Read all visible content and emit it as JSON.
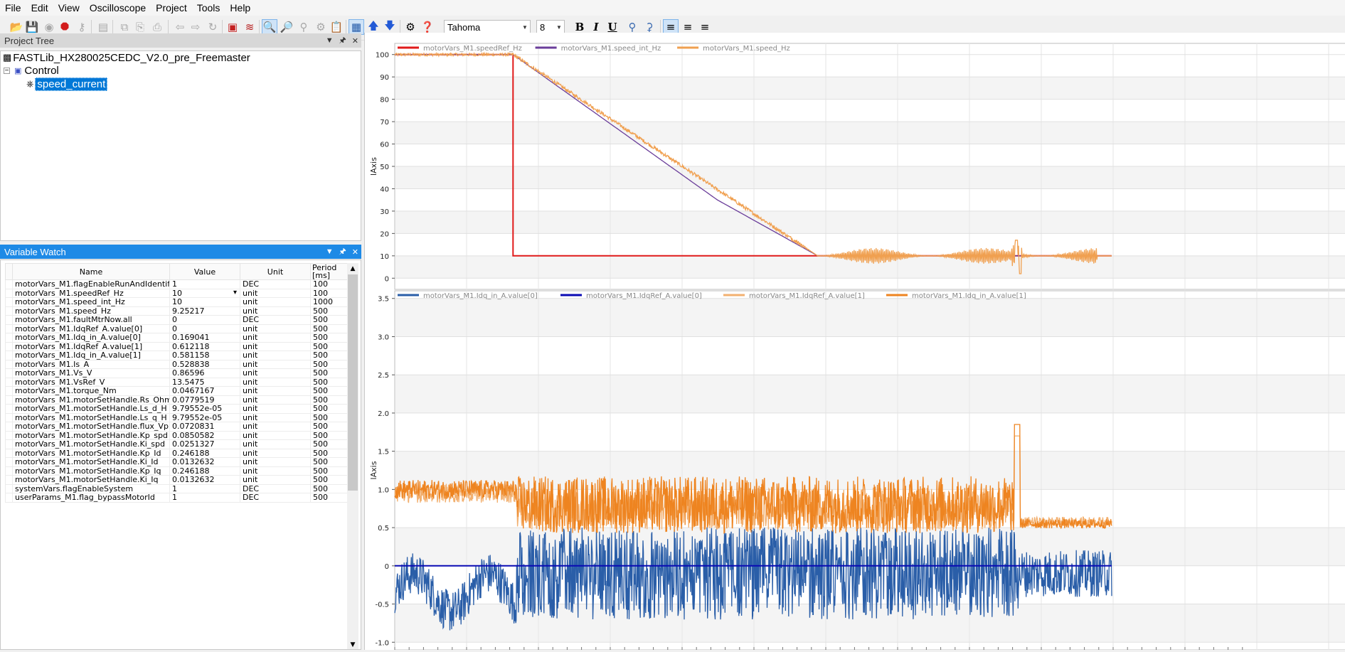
{
  "menu": [
    "File",
    "Edit",
    "View",
    "Oscilloscope",
    "Project",
    "Tools",
    "Help"
  ],
  "toolbar": {
    "font_name": "Tahoma",
    "font_size": "8"
  },
  "tree": {
    "title": "Project Tree",
    "root": "FASTLib_HX280025CEDC_V2.0_pre_Freemaster",
    "group": "Control",
    "item": "speed_current"
  },
  "watch": {
    "title": "Variable Watch",
    "columns": [
      "Name",
      "Value",
      "Unit",
      "Period [ms]"
    ],
    "rows": [
      {
        "name": "motorVars_M1.flagEnableRunAndIdentify",
        "value": "1",
        "unit": "DEC",
        "period": "100"
      },
      {
        "name": "motorVars_M1.speedRef_Hz",
        "value": "10",
        "unit": "unit",
        "period": "100"
      },
      {
        "name": "motorVars_M1.speed_int_Hz",
        "value": "10",
        "unit": "unit",
        "period": "1000"
      },
      {
        "name": "motorVars_M1.speed_Hz",
        "value": "9.25217",
        "unit": "unit",
        "period": "500"
      },
      {
        "name": "motorVars_M1.faultMtrNow.all",
        "value": "0",
        "unit": "DEC",
        "period": "500"
      },
      {
        "name": "motorVars_M1.IdqRef_A.value[0]",
        "value": "0",
        "unit": "unit",
        "period": "500"
      },
      {
        "name": "motorVars_M1.Idq_in_A.value[0]",
        "value": "0.169041",
        "unit": "unit",
        "period": "500"
      },
      {
        "name": "motorVars_M1.IdqRef_A.value[1]",
        "value": "0.612118",
        "unit": "unit",
        "period": "500"
      },
      {
        "name": "motorVars_M1.Idq_in_A.value[1]",
        "value": "0.581158",
        "unit": "unit",
        "period": "500"
      },
      {
        "name": "motorVars_M1.Is_A",
        "value": "0.528838",
        "unit": "unit",
        "period": "500"
      },
      {
        "name": "motorVars_M1.Vs_V",
        "value": "0.86596",
        "unit": "unit",
        "period": "500"
      },
      {
        "name": "motorVars_M1.VsRef_V",
        "value": "13.5475",
        "unit": "unit",
        "period": "500"
      },
      {
        "name": "motorVars_M1.torque_Nm",
        "value": "0.0467167",
        "unit": "unit",
        "period": "500"
      },
      {
        "name": "motorVars_M1.motorSetHandle.Rs_Ohm",
        "value": "0.0779519",
        "unit": "unit",
        "period": "500"
      },
      {
        "name": "motorVars_M1.motorSetHandle.Ls_d_H",
        "value": "9.79552e-05",
        "unit": "unit",
        "period": "500"
      },
      {
        "name": "motorVars_M1.motorSetHandle.Ls_q_H",
        "value": "9.79552e-05",
        "unit": "unit",
        "period": "500"
      },
      {
        "name": "motorVars_M1.motorSetHandle.flux_VpHz",
        "value": "0.0720831",
        "unit": "unit",
        "period": "500"
      },
      {
        "name": "motorVars_M1.motorSetHandle.Kp_spd",
        "value": "0.0850582",
        "unit": "unit",
        "period": "500"
      },
      {
        "name": "motorVars_M1.motorSetHandle.Ki_spd",
        "value": "0.0251327",
        "unit": "unit",
        "period": "500"
      },
      {
        "name": "motorVars_M1.motorSetHandle.Kp_Id",
        "value": "0.246188",
        "unit": "unit",
        "period": "500"
      },
      {
        "name": "motorVars_M1.motorSetHandle.Ki_Id",
        "value": "0.0132632",
        "unit": "unit",
        "period": "500"
      },
      {
        "name": "motorVars_M1.motorSetHandle.Kp_Iq",
        "value": "0.246188",
        "unit": "unit",
        "period": "500"
      },
      {
        "name": "motorVars_M1.motorSetHandle.Ki_Iq",
        "value": "0.0132632",
        "unit": "unit",
        "period": "500"
      },
      {
        "name": "systemVars.flagEnableSystem",
        "value": "1",
        "unit": "DEC",
        "period": "500"
      },
      {
        "name": "userParams_M1.flag_bypassMotorId",
        "value": "1",
        "unit": "DEC",
        "period": "500"
      }
    ]
  },
  "chart_data": [
    {
      "type": "line",
      "ylabel": "lAxis",
      "ylim": [
        -5,
        105
      ],
      "yticks": [
        0,
        10,
        20,
        30,
        40,
        50,
        60,
        70,
        80,
        90,
        100
      ],
      "legend_position": "top-left",
      "series": [
        {
          "name": "motorVars_M1.speedRef_Hz",
          "color": "#e01a1a",
          "x": [
            0,
            0.165,
            0.165,
            1
          ],
          "values": [
            100,
            100,
            10,
            10
          ]
        },
        {
          "name": "motorVars_M1.speed_int_Hz",
          "color": "#6a3d9a",
          "x": [
            0,
            0.165,
            0.45,
            0.59,
            1
          ],
          "values": [
            100,
            100,
            35,
            10,
            10
          ]
        },
        {
          "name": "motorVars_M1.speed_Hz",
          "color": "#f0a050",
          "x": [
            0,
            0.165,
            0.45,
            0.55,
            0.59,
            0.63,
            0.7,
            0.8,
            0.865,
            0.87,
            0.875,
            0.88,
            0.9,
            1
          ],
          "values": [
            100,
            101,
            35,
            18,
            11,
            7,
            13,
            8,
            17,
            3,
            14,
            9,
            11,
            10
          ]
        }
      ]
    },
    {
      "type": "line",
      "ylabel": "lAxis",
      "ylim": [
        -1.1,
        3.6
      ],
      "yticks": [
        -1.0,
        -0.5,
        0,
        0.5,
        1.0,
        1.5,
        2.0,
        2.5,
        3.0,
        3.5
      ],
      "legend_position": "top-left",
      "series": [
        {
          "name": "motorVars_M1.Idq_in_A.value[0]",
          "color": "#2a5ea8",
          "x": [
            0,
            0.1,
            0.17,
            0.9,
            0.97
          ],
          "values": [
            -0.6,
            -0.3,
            -1.0,
            0.4,
            0.1
          ]
        },
        {
          "name": "motorVars_M1.IdqRef_A.value[0]",
          "color": "#0a0ab4",
          "x": [
            0,
            0.97
          ],
          "values": [
            0,
            0
          ]
        },
        {
          "name": "motorVars_M1.IdqRef_A.value[1]",
          "color": "#f2b070",
          "x": [
            0,
            0.17,
            0.87,
            0.97
          ],
          "values": [
            0.9,
            1.0,
            1.8,
            0.6
          ]
        },
        {
          "name": "motorVars_M1.Idq_in_A.value[1]",
          "color": "#ee8420",
          "x": [
            0,
            0.17,
            0.87,
            0.97
          ],
          "values": [
            0.9,
            1.1,
            1.9,
            0.55
          ]
        }
      ]
    }
  ]
}
